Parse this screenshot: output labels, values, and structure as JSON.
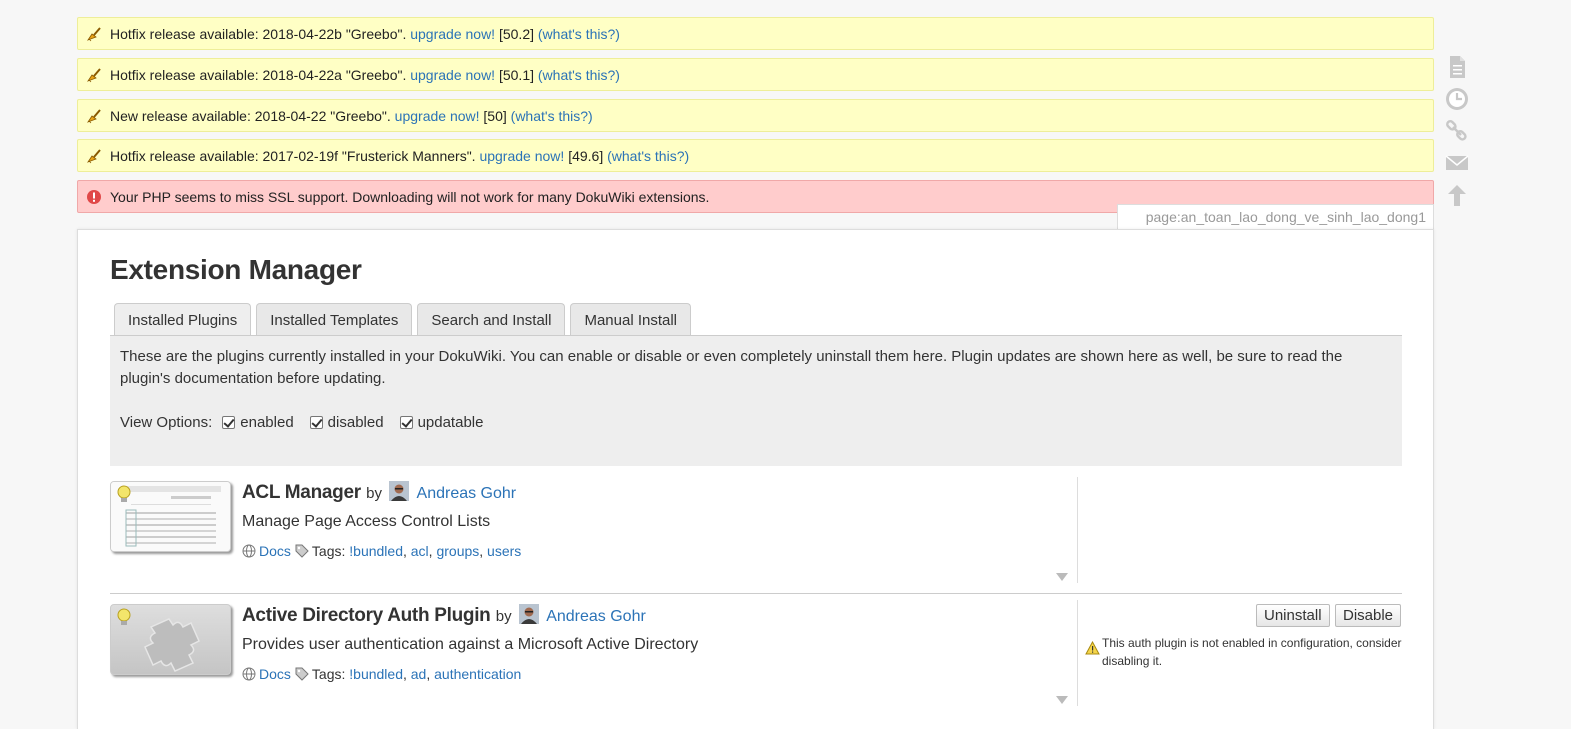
{
  "messages": [
    {
      "type": "info",
      "icon": "broom-icon",
      "text": "Hotfix release available: 2018-04-22b \"Greebo\".",
      "upgrade": "upgrade now!",
      "version": "[50.2]",
      "whats": "(what's this?)"
    },
    {
      "type": "info",
      "icon": "broom-icon",
      "text": "Hotfix release available: 2018-04-22a \"Greebo\".",
      "upgrade": "upgrade now!",
      "version": "[50.1]",
      "whats": "(what's this?)"
    },
    {
      "type": "info",
      "icon": "broom-icon",
      "text": "New release available: 2018-04-22 \"Greebo\".",
      "upgrade": "upgrade now!",
      "version": "[50]",
      "whats": "(what's this?)"
    },
    {
      "type": "info",
      "icon": "broom-icon",
      "text": "Hotfix release available: 2017-02-19f \"Frusterick Manners\".",
      "upgrade": "upgrade now!",
      "version": "[49.6]",
      "whats": "(what's this?)"
    }
  ],
  "error": {
    "icon": "error-icon",
    "text": "Your PHP seems to miss SSL support. Downloading will not work for many DokuWiki extensions."
  },
  "page_id": "page:an_toan_lao_dong_ve_sinh_lao_dong1",
  "page_tools": [
    "show-page-icon",
    "old-revisions-icon",
    "backlinks-icon",
    "subscribe-icon",
    "back-to-top-icon"
  ],
  "title": "Extension Manager",
  "tabs": [
    "Installed Plugins",
    "Installed Templates",
    "Search and Install",
    "Manual Install"
  ],
  "active_tab": "Installed Plugins",
  "panel": {
    "description": "These are the plugins currently installed in your DokuWiki. You can enable or disable or even completely uninstall them here. Plugin updates are shown here as well, be sure to read the plugin's documentation before updating.",
    "view_options_label": "View Options:",
    "options": [
      {
        "label": "enabled",
        "checked": true
      },
      {
        "label": "disabled",
        "checked": true
      },
      {
        "label": "updatable",
        "checked": true
      }
    ]
  },
  "extensions": [
    {
      "name": "ACL Manager",
      "by": "by",
      "author": "Andreas Gohr",
      "description": "Manage Page Access Control Lists",
      "docs": "Docs",
      "tags_label": "Tags:",
      "tags": [
        "!bundled",
        "acl",
        "groups",
        "users"
      ],
      "buttons": [],
      "notice": ""
    },
    {
      "name": "Active Directory Auth Plugin",
      "by": "by",
      "author": "Andreas Gohr",
      "description": "Provides user authentication against a Microsoft Active Directory",
      "docs": "Docs",
      "tags_label": "Tags:",
      "tags": [
        "!bundled",
        "ad",
        "authentication"
      ],
      "buttons": [
        "Uninstall",
        "Disable"
      ],
      "notice": "This auth plugin is not enabled in configuration, consider disabling it."
    }
  ],
  "colors": {
    "link": "#2b73b7",
    "info_bg": "#ffffc5",
    "error_bg": "#ffcccc",
    "panel_bg": "#eeeeee"
  }
}
